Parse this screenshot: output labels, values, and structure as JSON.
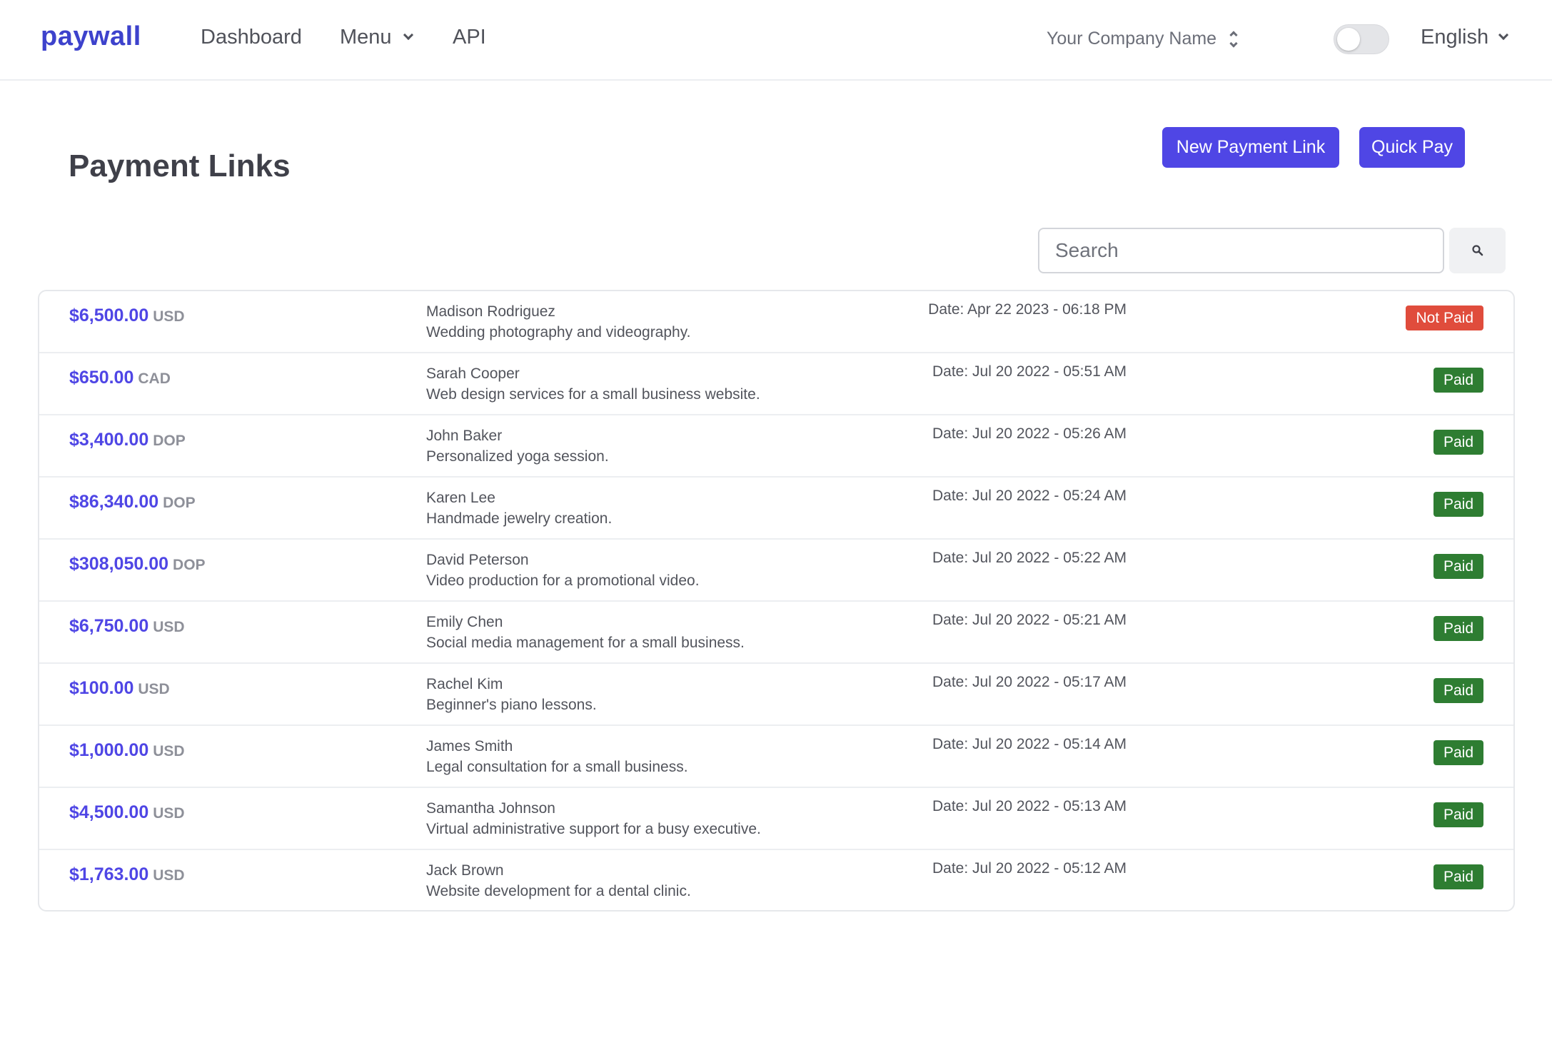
{
  "nav": {
    "brand": "paywall",
    "dashboard": "Dashboard",
    "menu": "Menu",
    "api": "API",
    "company": "Your Company Name",
    "language": "English"
  },
  "header": {
    "title": "Payment Links",
    "new_payment_link": "New Payment Link",
    "quick_pay": "Quick Pay"
  },
  "search": {
    "placeholder": "Search",
    "icon": "search-icon"
  },
  "colors": {
    "brand": "#3d42cc",
    "accent": "#4f46e5",
    "paid": "#2e7d32",
    "not_paid": "#e04c3c"
  },
  "payments": [
    {
      "amount": "$6,500.00",
      "currency": "USD",
      "name": "Madison Rodriguez",
      "description": "Wedding photography and videography.",
      "date": "Date: Apr 22 2023 - 06:18 PM",
      "status": "Not Paid"
    },
    {
      "amount": "$650.00",
      "currency": "CAD",
      "name": "Sarah Cooper",
      "description": "Web design services for a small business website.",
      "date": "Date: Jul 20 2022 - 05:51 AM",
      "status": "Paid"
    },
    {
      "amount": "$3,400.00",
      "currency": "DOP",
      "name": "John Baker",
      "description": "Personalized yoga session.",
      "date": "Date: Jul 20 2022 - 05:26 AM",
      "status": "Paid"
    },
    {
      "amount": "$86,340.00",
      "currency": "DOP",
      "name": "Karen Lee",
      "description": "Handmade jewelry creation.",
      "date": "Date: Jul 20 2022 - 05:24 AM",
      "status": "Paid"
    },
    {
      "amount": "$308,050.00",
      "currency": "DOP",
      "name": "David Peterson",
      "description": "Video production for a promotional video.",
      "date": "Date: Jul 20 2022 - 05:22 AM",
      "status": "Paid"
    },
    {
      "amount": "$6,750.00",
      "currency": "USD",
      "name": "Emily Chen",
      "description": "Social media management for a small business.",
      "date": "Date: Jul 20 2022 - 05:21 AM",
      "status": "Paid"
    },
    {
      "amount": "$100.00",
      "currency": "USD",
      "name": "Rachel Kim",
      "description": "Beginner's piano lessons.",
      "date": "Date: Jul 20 2022 - 05:17 AM",
      "status": "Paid"
    },
    {
      "amount": "$1,000.00",
      "currency": "USD",
      "name": "James Smith",
      "description": "Legal consultation for a small business.",
      "date": "Date: Jul 20 2022 - 05:14 AM",
      "status": "Paid"
    },
    {
      "amount": "$4,500.00",
      "currency": "USD",
      "name": "Samantha Johnson",
      "description": "Virtual administrative support for a busy executive.",
      "date": "Date: Jul 20 2022 - 05:13 AM",
      "status": "Paid"
    },
    {
      "amount": "$1,763.00",
      "currency": "USD",
      "name": "Jack Brown",
      "description": "Website development for a dental clinic.",
      "date": "Date: Jul 20 2022 - 05:12 AM",
      "status": "Paid"
    }
  ]
}
